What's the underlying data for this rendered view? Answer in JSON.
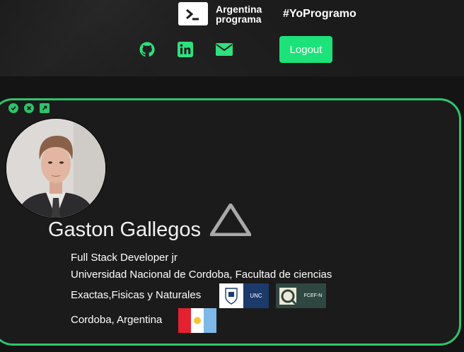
{
  "header": {
    "brand_line1": "Argentina",
    "brand_line2": "programa",
    "hashtag": "#YoProgramo",
    "social_icons": [
      "github-icon",
      "linkedin-icon",
      "envelope-icon"
    ],
    "logout_label": "Logout",
    "accent_color": "#1ce27a"
  },
  "card": {
    "tool_icons": [
      "check-icon",
      "close-icon",
      "expand-icon"
    ],
    "border_color": "#30c46c"
  },
  "profile": {
    "name": "Gaston Gallegos",
    "role": "Full Stack Developer jr",
    "education_line1": "Universidad Nacional de Cordoba, Facultad de ciencias",
    "education_line2": "Exactas,Fisicas y Naturales",
    "location": "Cordoba, Argentina",
    "badge_unc": "UNC",
    "badge_fcefyn": "FCEF-N"
  }
}
